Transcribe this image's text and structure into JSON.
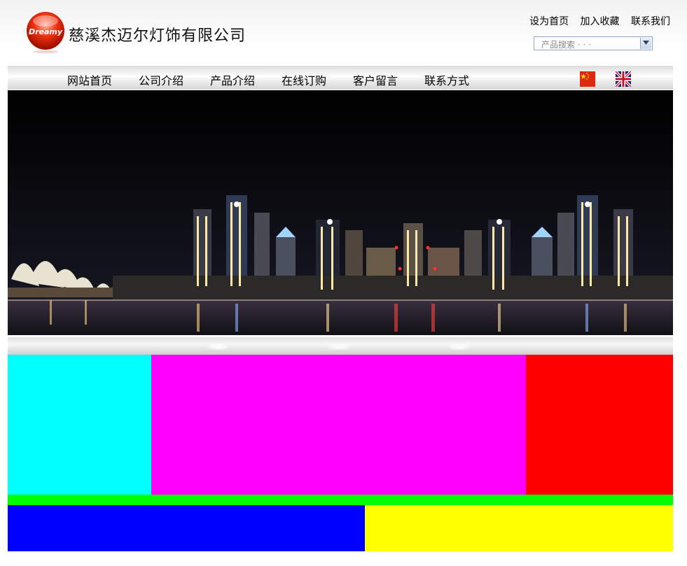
{
  "header": {
    "logo_text": "Dreamy",
    "company_name": "慈溪杰迈尔灯饰有限公司",
    "top_links": [
      "设为首页",
      "加入收藏",
      "联系我们"
    ],
    "search_placeholder": "产品搜索 · · ·"
  },
  "nav": {
    "items": [
      "网站首页",
      "公司介绍",
      "产品介绍",
      "在线订购",
      "客户留言",
      "联系方式"
    ],
    "flags": [
      "china-flag-icon",
      "uk-flag-icon"
    ]
  },
  "blocks": {
    "colors": [
      "#00ffff",
      "#ff00ff",
      "#ff0000",
      "#00ff00",
      "#0000ff",
      "#ffff00"
    ]
  }
}
